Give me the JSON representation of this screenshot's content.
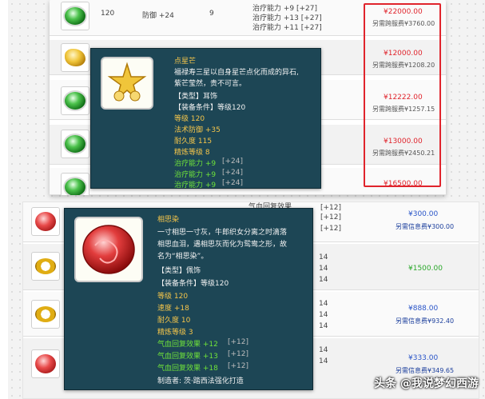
{
  "top_panel": {
    "rows": [
      {
        "level": "120",
        "attr": "防御 +24",
        "num": "9",
        "bonus_lines": [
          "治疗能力 +9 [+27]",
          "治疗能力 +13 [+27]",
          "治疗能力 +11 [+27]"
        ],
        "gem": "green-gem",
        "price": "¥22000.00",
        "extra": "另需跨服费¥3760.00"
      },
      {
        "gem": "gold-gem",
        "price": "¥12000.00",
        "extra": "另需跨服费¥1208.20"
      },
      {
        "gem": "green-gem",
        "price": "¥12222.00",
        "extra": "另需跨服费¥1257.15"
      },
      {
        "gem": "green-gem",
        "price": "¥13000.00",
        "extra": "另需跨服费¥2450.21"
      },
      {
        "gem": "green-gem",
        "price": "¥16500.00",
        "extra": ""
      }
    ]
  },
  "tooltip_top": {
    "name": "点星芒",
    "desc_1": "福禄寿三星以自身星芒点化而成的异石,",
    "desc_2": "紫芒莹然，贵不可言。",
    "type": "【类型】耳饰",
    "equip": "【装备条件】等级120",
    "level": "等级 120",
    "mdef": "法术防御 +35",
    "durability": "耐久度 115",
    "refine": "精炼等级 8",
    "heal": [
      {
        "label": "治疗能力 +9",
        "bonus": "[+24]"
      },
      {
        "label": "治疗能力 +9",
        "bonus": "[+24]"
      },
      {
        "label": "治疗能力 +9",
        "bonus": "[+24]"
      }
    ]
  },
  "bottom_panel": {
    "partial_text": [
      "气血回复效果",
      "[+12]",
      "[+12]",
      "[+12]"
    ],
    "right_nums": [
      "14",
      "14",
      "14",
      "14",
      "14",
      "14",
      "14",
      "14"
    ],
    "rows": [
      {
        "gem": "red-gem",
        "price": "¥300.00",
        "extra": "另需信息费¥300.00",
        "price_style": "blue"
      },
      {
        "gem": "gold-ring",
        "price": "¥1500.00",
        "extra": "",
        "price_style": "green"
      },
      {
        "gem": "gold-ring",
        "price": "¥888.00",
        "extra": "另需信息费¥932.40",
        "price_style": "blue"
      },
      {
        "gem": "red-gem",
        "price": "¥333.00",
        "extra": "另需信息费¥349.65",
        "price_style": "blue"
      }
    ]
  },
  "tooltip_bottom": {
    "name": "相思染",
    "desc_1": "一寸相思一寸灰，牛郎织女分离之时滴落",
    "desc_2": "相思血泪，遇相思灰而化为鸳鸯之形，故",
    "desc_3": "名为“相思染”。",
    "type": "【类型】佩饰",
    "equip": "【装备条件】等级120",
    "level": "等级 120",
    "speed": "速度 +18",
    "durability": "耐久度 10",
    "refine": "精炼等级 3",
    "effects": [
      {
        "label": "气血回复效果 +12",
        "bonus": "[+12]"
      },
      {
        "label": "气血回复效果 +13",
        "bonus": "[+12]"
      },
      {
        "label": "气血回复效果 +18",
        "bonus": "[+12]"
      }
    ],
    "maker": "制造者: 茨·踏西法强化打造"
  },
  "watermark": "头条 @我说梦幻西游",
  "colors": {
    "price_red": "#e0242c",
    "tooltip_bg": "#1d4655",
    "title_gold": "#f5c54a",
    "stat_green": "#6fe23a",
    "price_blue": "#2a55c8"
  }
}
